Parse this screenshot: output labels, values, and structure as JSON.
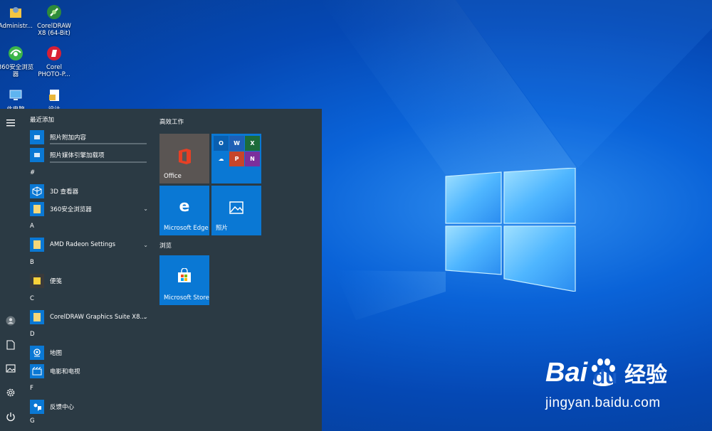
{
  "desktop": {
    "icons": [
      {
        "label": "Administr...",
        "icon": "user-folder-icon"
      },
      {
        "label": "CorelDRAW X8 (64-Bit)",
        "icon": "coreldraw-icon"
      },
      {
        "label": "360安全浏览器",
        "icon": "browser-360-icon"
      },
      {
        "label": "Corel PHOTO-P...",
        "icon": "corel-photopaint-icon"
      },
      {
        "label": "此电脑",
        "icon": "this-pc-icon"
      },
      {
        "label": "设计",
        "icon": "file-icon"
      }
    ]
  },
  "start_menu": {
    "recent_header": "最近添加",
    "recent_items": [
      "照片附加内容",
      "照片媒体引擎加载项"
    ],
    "sections": [
      {
        "letter": "#",
        "apps": [
          {
            "label": "3D 查看器",
            "icon": "cube-3d-icon"
          },
          {
            "label": "360安全浏览器",
            "icon": "folder-icon",
            "expandable": true
          }
        ]
      },
      {
        "letter": "A",
        "apps": [
          {
            "label": "AMD Radeon Settings",
            "icon": "folder-icon",
            "expandable": true
          }
        ]
      },
      {
        "letter": "B",
        "apps": [
          {
            "label": "便笺",
            "icon": "sticky-notes-icon"
          }
        ]
      },
      {
        "letter": "C",
        "apps": [
          {
            "label": "CorelDRAW Graphics Suite X8...",
            "icon": "folder-icon",
            "expandable": true
          }
        ]
      },
      {
        "letter": "D",
        "apps": [
          {
            "label": "地图",
            "icon": "maps-icon"
          },
          {
            "label": "电影和电视",
            "icon": "film-icon"
          }
        ]
      },
      {
        "letter": "F",
        "apps": [
          {
            "label": "反馈中心",
            "icon": "feedback-icon"
          }
        ]
      },
      {
        "letter": "G",
        "apps": []
      }
    ],
    "tile_groups": {
      "work_title": "高效工作",
      "browse_title": "浏览"
    },
    "tiles": {
      "office": "Office",
      "edge": "Microsoft Edge",
      "photos": "照片",
      "store": "Microsoft Store"
    }
  },
  "watermark": {
    "brand": "Bai",
    "brand2": "du",
    "cn": "经验",
    "url": "jingyan.baidu.com"
  },
  "colors": {
    "accent": "#0a78d4",
    "start_bg": "#2b3a44",
    "office_tile": "#5a5553"
  }
}
